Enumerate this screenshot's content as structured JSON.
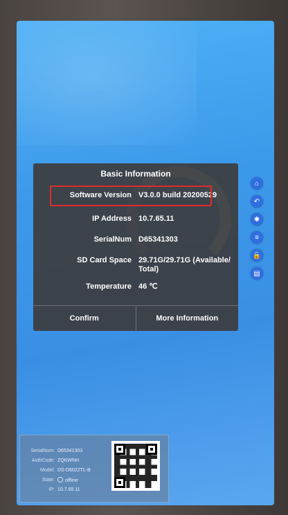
{
  "dialog": {
    "title": "Basic Information",
    "fields": [
      {
        "label": "Software Version",
        "value": "V3.0.0 build 20200529"
      },
      {
        "label": "IP Address",
        "value": "10.7.65.11"
      },
      {
        "label": "SerialNum",
        "value": "D65341303"
      },
      {
        "label": "SD Card Space",
        "value": "29.71G/29.71G (Available/ Total)"
      },
      {
        "label": "Temperature",
        "value": "46 ℃"
      }
    ],
    "confirm_label": "Confirm",
    "more_label": "More Information"
  },
  "sidebar": {
    "icons": [
      "home-icon",
      "back-icon",
      "gear-icon",
      "list-icon",
      "lock-icon",
      "document-icon"
    ],
    "glyphs": [
      "⌂",
      "↶",
      "✱",
      "≡",
      "🔒",
      "▤"
    ]
  },
  "device_info": {
    "serial_label": "SerialNum:",
    "serial_value": "D65341303",
    "authcode_label": "AuthCode:",
    "authcode_value": "ZQKWNH",
    "model_label": "Model:",
    "model_value": "DS-D6022TL-B",
    "state_label": "State:",
    "state_value": "offline",
    "ip_label": "IP:",
    "ip_value": "10.7.65.11"
  },
  "colors": {
    "highlight": "#e02b2b",
    "accent": "#2f6ee0",
    "screen": "#3c99ea"
  }
}
